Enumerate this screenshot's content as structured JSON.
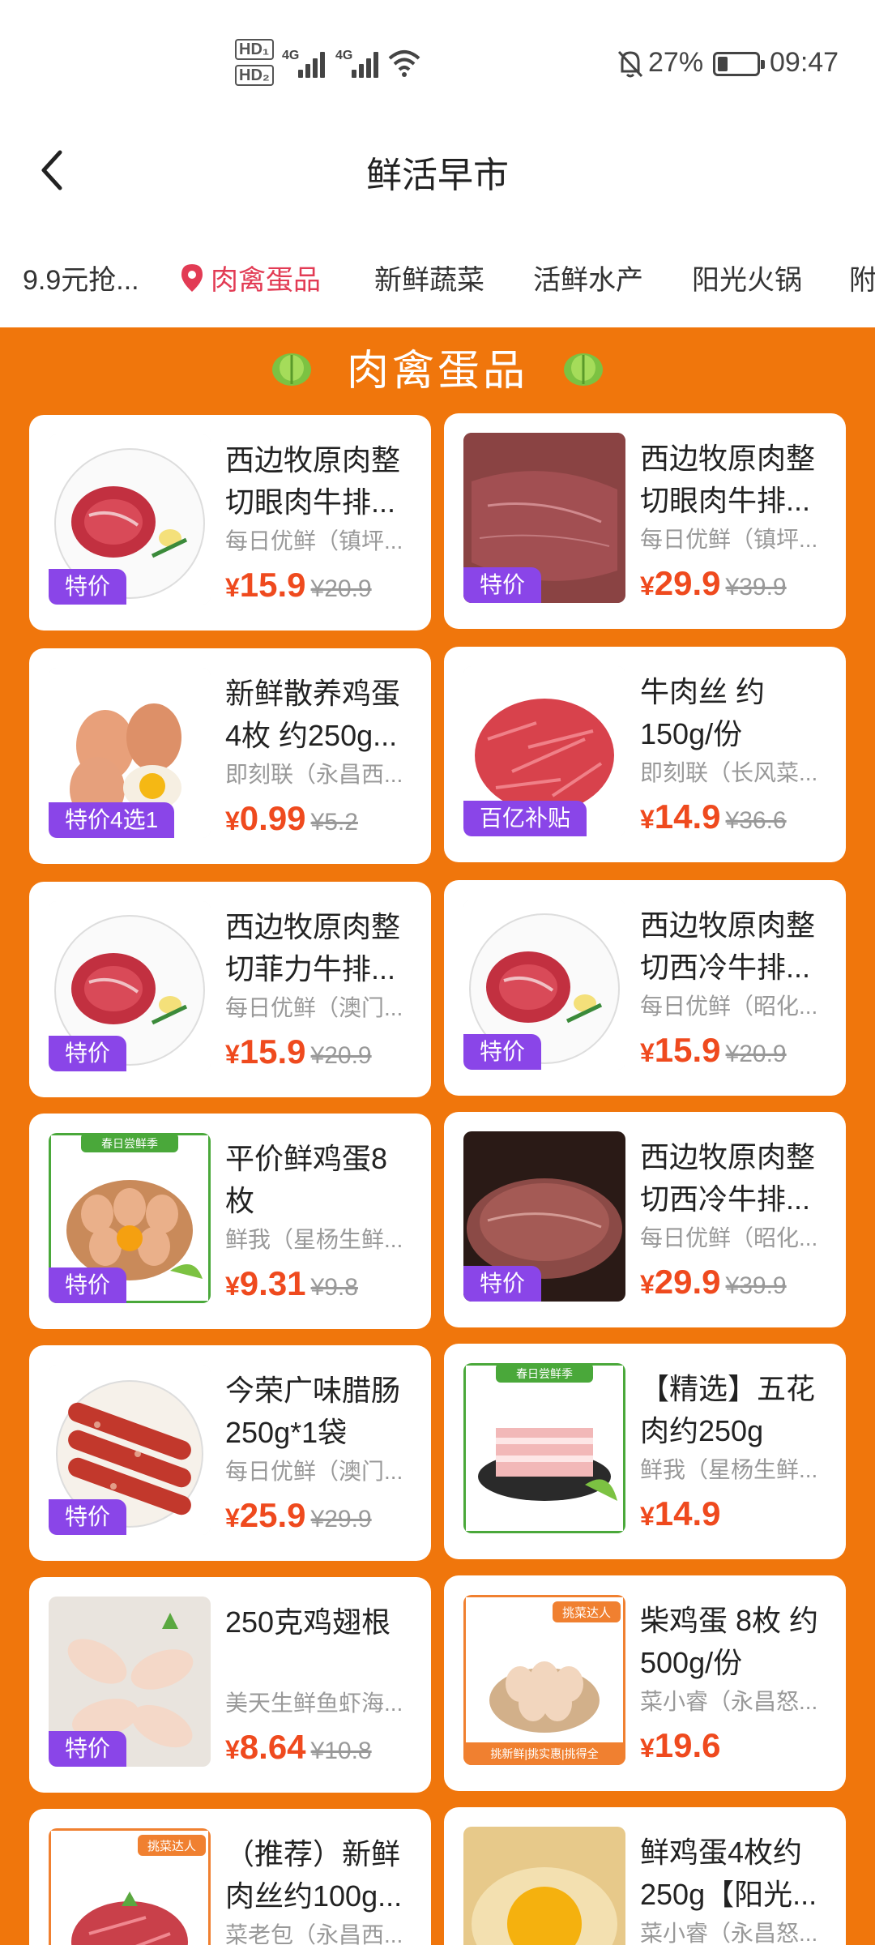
{
  "status_bar": {
    "hd1": "HD₁",
    "hd2": "HD₂",
    "net1": "4G",
    "net2": "4G",
    "battery_pct": "27%",
    "battery_level": 0.27,
    "time": "09:47",
    "icons": [
      "signal-icon",
      "wifi-icon",
      "mute-icon",
      "battery-icon"
    ]
  },
  "header": {
    "title": "鲜活早市",
    "back_icon": "chevron-left-icon"
  },
  "tabs": [
    {
      "label": "9.9元抢...",
      "active": false
    },
    {
      "label": "肉禽蛋品",
      "active": true
    },
    {
      "label": "新鲜蔬菜",
      "active": false
    },
    {
      "label": "活鲜水产",
      "active": false
    },
    {
      "label": "阳光火锅",
      "active": false
    },
    {
      "label": "附",
      "active": false
    }
  ],
  "section": {
    "title": "肉禽蛋品"
  },
  "colors": {
    "panel": "#f0760c",
    "tag": "#8a45e8",
    "price": "#ef4a1e",
    "active_tab": "#e23b54"
  },
  "products": [
    {
      "name": "西边牧原肉整切眼肉牛排...",
      "shop": "每日优鲜（镇坪...",
      "yen": "¥",
      "price": "15.9",
      "old_price": "¥20.9",
      "tag": "特价",
      "image": "steak-plate"
    },
    {
      "name": "西边牧原肉整切眼肉牛排...",
      "shop": "每日优鲜（镇坪...",
      "yen": "¥",
      "price": "29.9",
      "old_price": "¥39.9",
      "tag": "特价",
      "image": "raw-beef"
    },
    {
      "name": "新鲜散养鸡蛋4枚 约250g...",
      "shop": "即刻联（永昌西...",
      "yen": "¥",
      "price": "0.99",
      "old_price": "¥5.2",
      "tag": "特价4选1",
      "image": "eggs"
    },
    {
      "name": "牛肉丝 约150g/份",
      "shop": "即刻联（长风菜...",
      "yen": "¥",
      "price": "14.9",
      "old_price": "¥36.6",
      "tag": "百亿补贴",
      "image": "shredded-beef"
    },
    {
      "name": "西边牧原肉整切菲力牛排...",
      "shop": "每日优鲜（澳门...",
      "yen": "¥",
      "price": "15.9",
      "old_price": "¥20.9",
      "tag": "特价",
      "image": "steak-plate"
    },
    {
      "name": "西边牧原肉整切西冷牛排...",
      "shop": "每日优鲜（昭化...",
      "yen": "¥",
      "price": "15.9",
      "old_price": "¥20.9",
      "tag": "特价",
      "image": "steak-plate"
    },
    {
      "name": "平价鲜鸡蛋8枚",
      "shop": "鲜我（星杨生鲜...",
      "yen": "¥",
      "price": "9.31",
      "old_price": "¥9.8",
      "tag": "特价",
      "image": "eggs-basket",
      "banner": "春日尝鲜季"
    },
    {
      "name": "西边牧原肉整切西冷牛排...",
      "shop": "每日优鲜（昭化...",
      "yen": "¥",
      "price": "29.9",
      "old_price": "¥39.9",
      "tag": "特价",
      "image": "raw-beef-dark"
    },
    {
      "name": "今荣广味腊肠250g*1袋",
      "shop": "每日优鲜（澳门...",
      "yen": "¥",
      "price": "25.9",
      "old_price": "¥29.9",
      "tag": "特价",
      "image": "sausage"
    },
    {
      "name": "【精选】五花肉约250g",
      "shop": "鲜我（星杨生鲜...",
      "yen": "¥",
      "price": "14.9",
      "old_price": "",
      "tag": "",
      "image": "pork-belly",
      "banner": "春日尝鲜季"
    },
    {
      "name": "250克鸡翅根",
      "shop": "美天生鲜鱼虾海...",
      "yen": "¥",
      "price": "8.64",
      "old_price": "¥10.8",
      "tag": "特价",
      "image": "chicken"
    },
    {
      "name": "柴鸡蛋 8枚 约500g/份",
      "shop": "菜小睿（永昌怒...",
      "yen": "¥",
      "price": "19.6",
      "old_price": "",
      "tag": "",
      "image": "eggs-bowl",
      "banner": "挑菜达人",
      "footer": "挑新鲜|挑实惠|挑得全"
    },
    {
      "name": "（推荐）新鲜肉丝约100g...",
      "shop": "菜老包（永昌西...",
      "yen": "",
      "price": "",
      "old_price": "",
      "tag": "",
      "image": "minced-pork",
      "banner": "挑菜达人"
    },
    {
      "name": "鲜鸡蛋4枚约250g【阳光...",
      "shop": "菜小睿（永昌怒...",
      "yen": "",
      "price": "",
      "old_price": "",
      "tag": "",
      "image": "egg-yolk"
    }
  ]
}
